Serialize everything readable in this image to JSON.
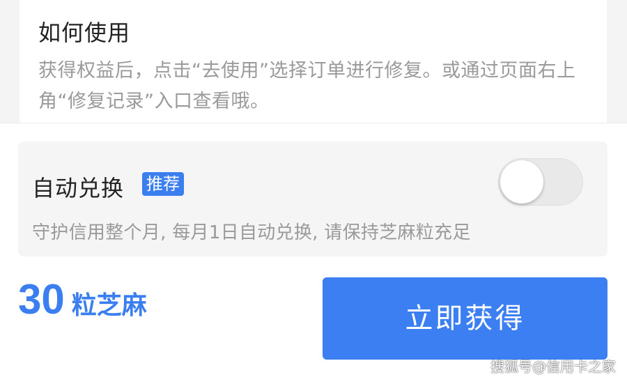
{
  "howto": {
    "title": "如何使用",
    "description": "获得权益后，点击“去使用”选择订单进行修复。或通过页面右上角“修复记录”入口查看哦。"
  },
  "auto_exchange": {
    "title": "自动兑换",
    "tag": "推荐",
    "toggle_on": false,
    "description": "守护信用整个月, 每月1日自动兑换, 请保持芝麻粒充足"
  },
  "footer": {
    "price_value": "30",
    "price_unit": "粒芝麻",
    "button_label": "立即获得"
  },
  "watermark": "搜狐号@信用卡之家",
  "colors": {
    "accent": "#3a7ef0",
    "button": "#3b7ff2"
  }
}
